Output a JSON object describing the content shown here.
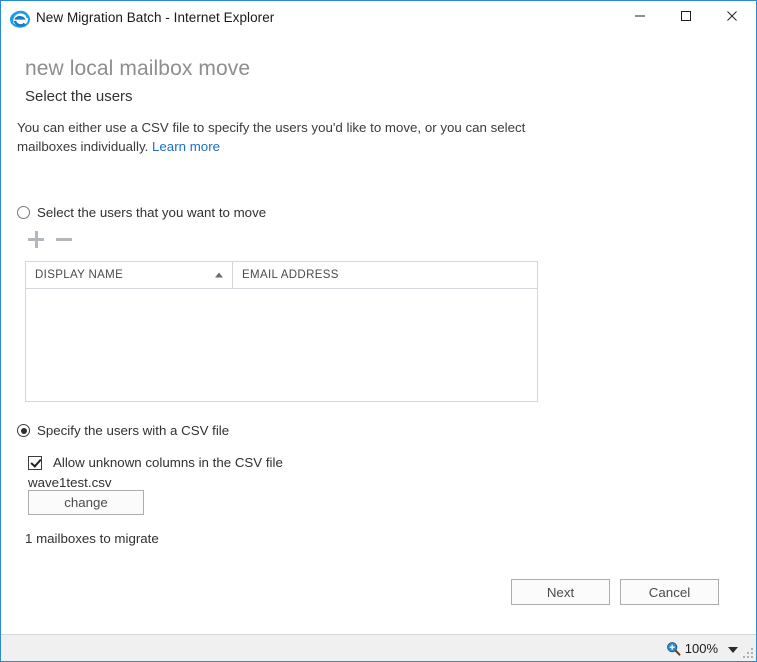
{
  "window": {
    "title": "New Migration Batch - Internet Explorer",
    "app_icon": "internet-explorer-icon",
    "controls": {
      "minimize": "minimize-icon",
      "maximize": "maximize-icon",
      "close": "close-icon"
    },
    "frame_color": "#2a8ad4"
  },
  "page": {
    "heading": "new local mailbox move",
    "subheading": "Select the users",
    "description_before_link": "You can either use a CSV file to specify the users you'd like to move, or you can select mailboxes individually. ",
    "learn_more": "Learn more"
  },
  "option_select_users": {
    "label": "Select the users that you want to move",
    "selected": false,
    "toolbar": {
      "add": "add-icon",
      "remove": "remove-icon"
    },
    "grid": {
      "columns": [
        {
          "label": "DISPLAY NAME",
          "sorted": true,
          "sort_direction": "ascending"
        },
        {
          "label": "EMAIL ADDRESS",
          "sorted": false,
          "sort_direction": ""
        }
      ],
      "rows": []
    }
  },
  "option_csv": {
    "label": "Specify the users with a CSV file",
    "selected": true,
    "allow_unknown_columns": {
      "label": "Allow unknown columns in the CSV file",
      "checked": true
    },
    "file_name": "wave1test.csv",
    "change_button": "change",
    "mailbox_count_text": "1 mailboxes to migrate"
  },
  "footer": {
    "next_label": "Next",
    "cancel_label": "Cancel"
  },
  "statusbar": {
    "zoom_icon": "zoom-magnifier-icon",
    "zoom_level": "100%",
    "caret": "chevron-down-icon",
    "grip": "resize-grip-icon"
  }
}
